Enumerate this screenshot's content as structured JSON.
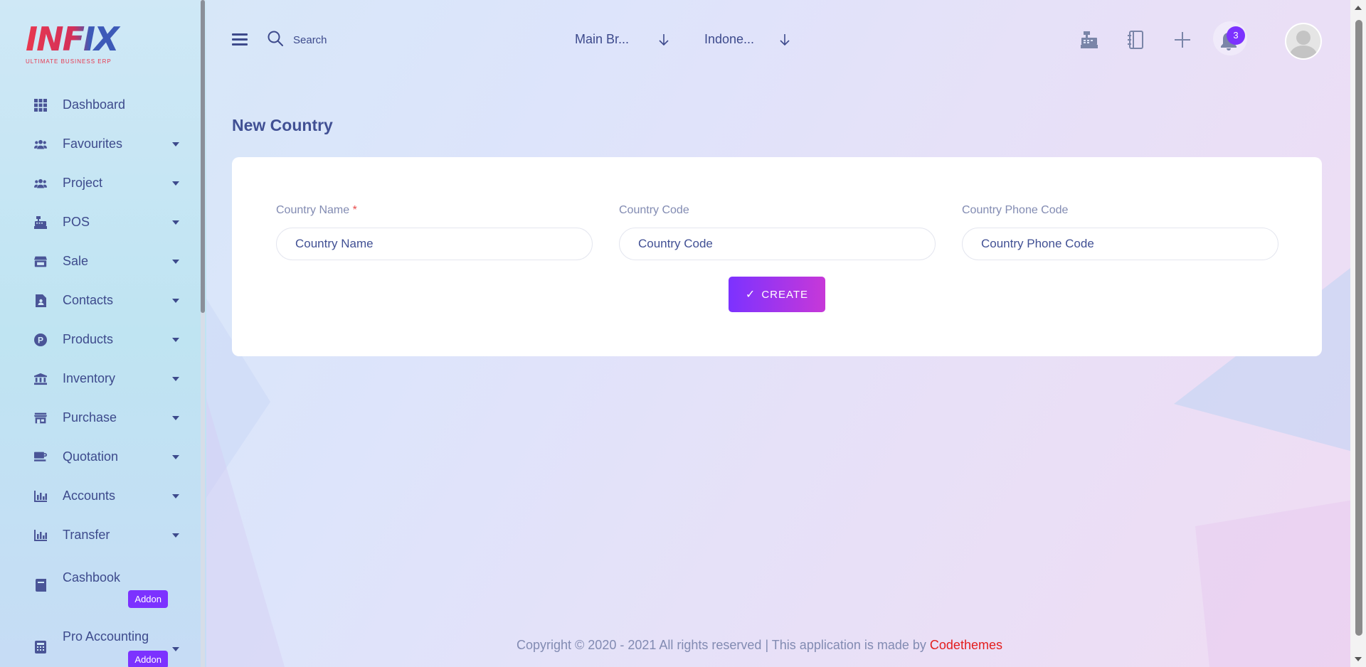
{
  "brand": {
    "logo_text": "INFIX",
    "logo_subtitle": "ULTIMATE BUSINESS ERP",
    "accent_color": "#7c32ff",
    "link_color": "#e31d1d"
  },
  "sidebar": {
    "items": [
      {
        "label": "Dashboard",
        "icon": "grid-icon",
        "has_caret": false
      },
      {
        "label": "Favourites",
        "icon": "users-icon",
        "has_caret": true
      },
      {
        "label": "Project",
        "icon": "users-icon",
        "has_caret": true
      },
      {
        "label": "POS",
        "icon": "cash-register-icon",
        "has_caret": true
      },
      {
        "label": "Sale",
        "icon": "store-icon",
        "has_caret": true
      },
      {
        "label": "Contacts",
        "icon": "contact-file-icon",
        "has_caret": true
      },
      {
        "label": "Products",
        "icon": "product-p-icon",
        "has_caret": true
      },
      {
        "label": "Inventory",
        "icon": "bank-icon",
        "has_caret": true
      },
      {
        "label": "Purchase",
        "icon": "shop-icon",
        "has_caret": true
      },
      {
        "label": "Quotation",
        "icon": "mug-icon",
        "has_caret": true
      },
      {
        "label": "Accounts",
        "icon": "bar-chart-icon",
        "has_caret": true
      },
      {
        "label": "Transfer",
        "icon": "bar-chart-icon",
        "has_caret": true
      },
      {
        "label": "Cashbook",
        "icon": "book-icon",
        "has_caret": false,
        "badge": "Addon"
      },
      {
        "label": "Pro Accounting",
        "icon": "calculator-icon",
        "has_caret": true,
        "badge": "Addon"
      }
    ]
  },
  "header": {
    "search_placeholder": "Search",
    "branch_select": "Main Br...",
    "country_select": "Indone...",
    "notification_count": "3"
  },
  "page": {
    "title": "New Country"
  },
  "form": {
    "country_name": {
      "label": "Country Name",
      "required_mark": "*",
      "placeholder": "Country Name",
      "value": ""
    },
    "country_code": {
      "label": "Country Code",
      "placeholder": "Country Code",
      "value": ""
    },
    "country_phone_code": {
      "label": "Country Phone Code",
      "placeholder": "Country Phone Code",
      "value": ""
    },
    "submit_label": "CREATE"
  },
  "footer": {
    "text": "Copyright © 2020 - 2021 All rights reserved | This application is made by ",
    "link_text": "Codethemes"
  }
}
